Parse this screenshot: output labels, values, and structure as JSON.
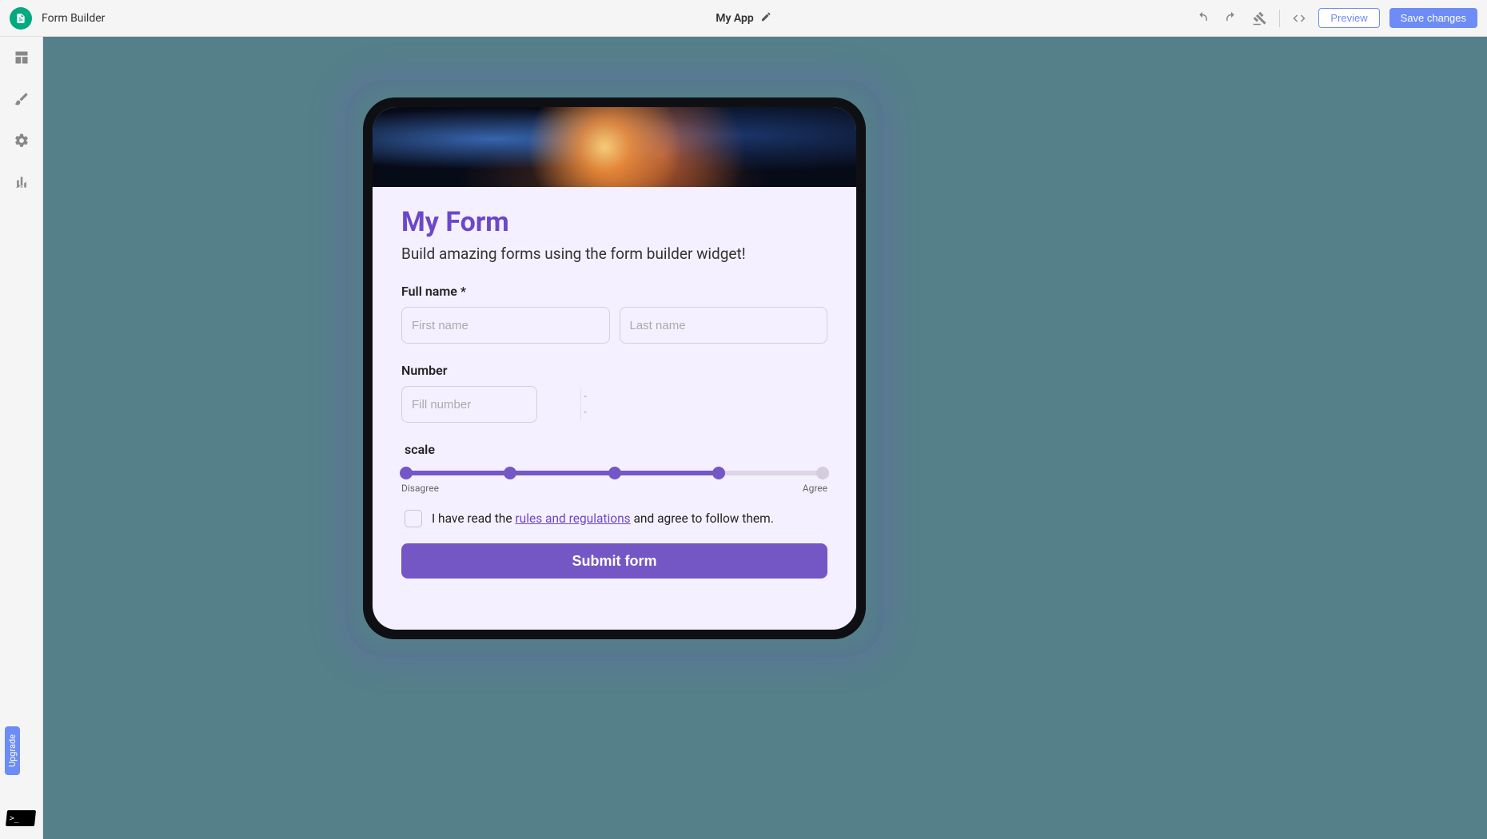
{
  "header": {
    "brand": "Form Builder",
    "app_title": "My App",
    "preview_label": "Preview",
    "save_label": "Save changes"
  },
  "sidebar": {
    "upgrade_label": "Upgrade"
  },
  "form": {
    "title": "My Form",
    "subtitle": "Build amazing forms using the form builder widget!",
    "fields": {
      "fullname_label": "Full name *",
      "first_name_placeholder": "First name",
      "last_name_placeholder": "Last name",
      "number_label": "Number",
      "number_placeholder": "Fill number",
      "scale_label": "scale",
      "scale_min_label": "Disagree",
      "scale_max_label": "Agree",
      "scale_steps": 5,
      "scale_value": 4,
      "consent_pre": "I have read the ",
      "consent_link": "rules and regulations",
      "consent_post": " and agree to follow them.",
      "submit_label": "Submit form"
    }
  }
}
